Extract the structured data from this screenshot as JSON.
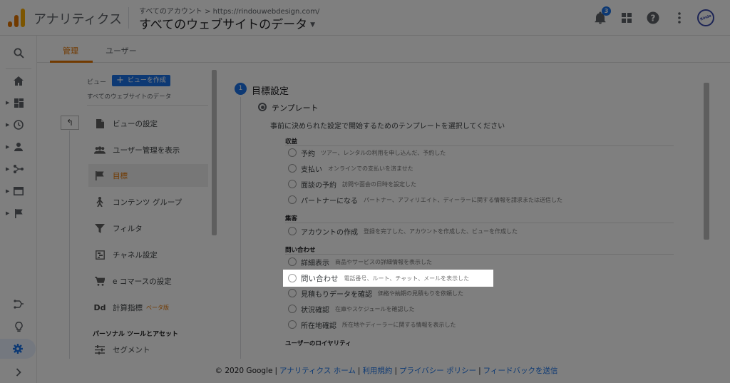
{
  "app": {
    "title": "アナリティクス",
    "breadcrumb": "すべてのアカウント > https://rindouwebdesign.com/",
    "view_name": "すべてのウェブサイトのデータ",
    "notification_count": "3",
    "avatar_text": "Rindo"
  },
  "colors": {
    "accent_orange": "#e37400",
    "primary_blue": "#1a73e8",
    "logo_dark": "#e37400",
    "logo_light": "#f9ab00"
  },
  "tabs": [
    {
      "label": "管理"
    },
    {
      "label": "ユーザー"
    }
  ],
  "admin": {
    "column_header": "ビュー",
    "create_view_label": "ビューを作成",
    "view_subtitle": "すべてのウェブサイトのデータ",
    "items": [
      {
        "label": "ビューの設定",
        "icon": "file-icon"
      },
      {
        "label": "ユーザー管理を表示",
        "icon": "users-icon"
      },
      {
        "label": "目標",
        "icon": "flag-icon"
      },
      {
        "label": "コンテンツ グループ",
        "icon": "person-walking-icon"
      },
      {
        "label": "フィルタ",
        "icon": "filter-icon"
      },
      {
        "label": "チャネル設定",
        "icon": "channel-icon"
      },
      {
        "label": "e コマースの設定",
        "icon": "cart-icon"
      },
      {
        "label": "計算指標",
        "icon": "dd-icon",
        "badge": "ベータ版"
      },
      {
        "label": "セグメント",
        "icon": "sliders-icon"
      }
    ],
    "section_personal_tools": "パーソナル ツールとアセット"
  },
  "goal": {
    "step_number": "1",
    "step_title": "目標設定",
    "template_label": "テンプレート",
    "template_desc": "事前に決められた設定で開始するためのテンプレートを選択してください",
    "groups": [
      {
        "title": "収益",
        "options": [
          {
            "name": "予約",
            "desc": "ツアー、レンタルの利用を申し込んだ、予約した"
          },
          {
            "name": "支払い",
            "desc": "オンラインでの支払いを済ませた"
          },
          {
            "name": "面談の予約",
            "desc": "訪問や面会の日時を設定した"
          },
          {
            "name": "パートナーになる",
            "desc": "パートナー、アフィリエイト、ディーラーに関する情報を請求または送信した"
          }
        ]
      },
      {
        "title": "集客",
        "options": [
          {
            "name": "アカウントの作成",
            "desc": "登録を完了した、アカウントを作成した、ビューを作成した"
          }
        ]
      },
      {
        "title": "問い合わせ",
        "options": [
          {
            "name": "詳細表示",
            "desc": "商品やサービスの詳細情報を表示した"
          },
          {
            "name": "問い合わせ",
            "desc": "電話番号、ルート、チャット、メールを表示した"
          },
          {
            "name": "見積もりデータを確認",
            "desc": "価格や納期の見積もりを依頼した"
          },
          {
            "name": "状況確認",
            "desc": "在庫やスケジュールを確認した"
          },
          {
            "name": "所在地確認",
            "desc": "所在地やディーラーに関する情報を表示した"
          }
        ]
      },
      {
        "title": "ユーザーのロイヤリティ",
        "options": []
      }
    ]
  },
  "footer": {
    "copyright": "© 2020 Google",
    "links": [
      "アナリティクス ホーム",
      "利用規約",
      "プライバシー ポリシー",
      "フィードバックを送信"
    ],
    "separator": "|"
  }
}
